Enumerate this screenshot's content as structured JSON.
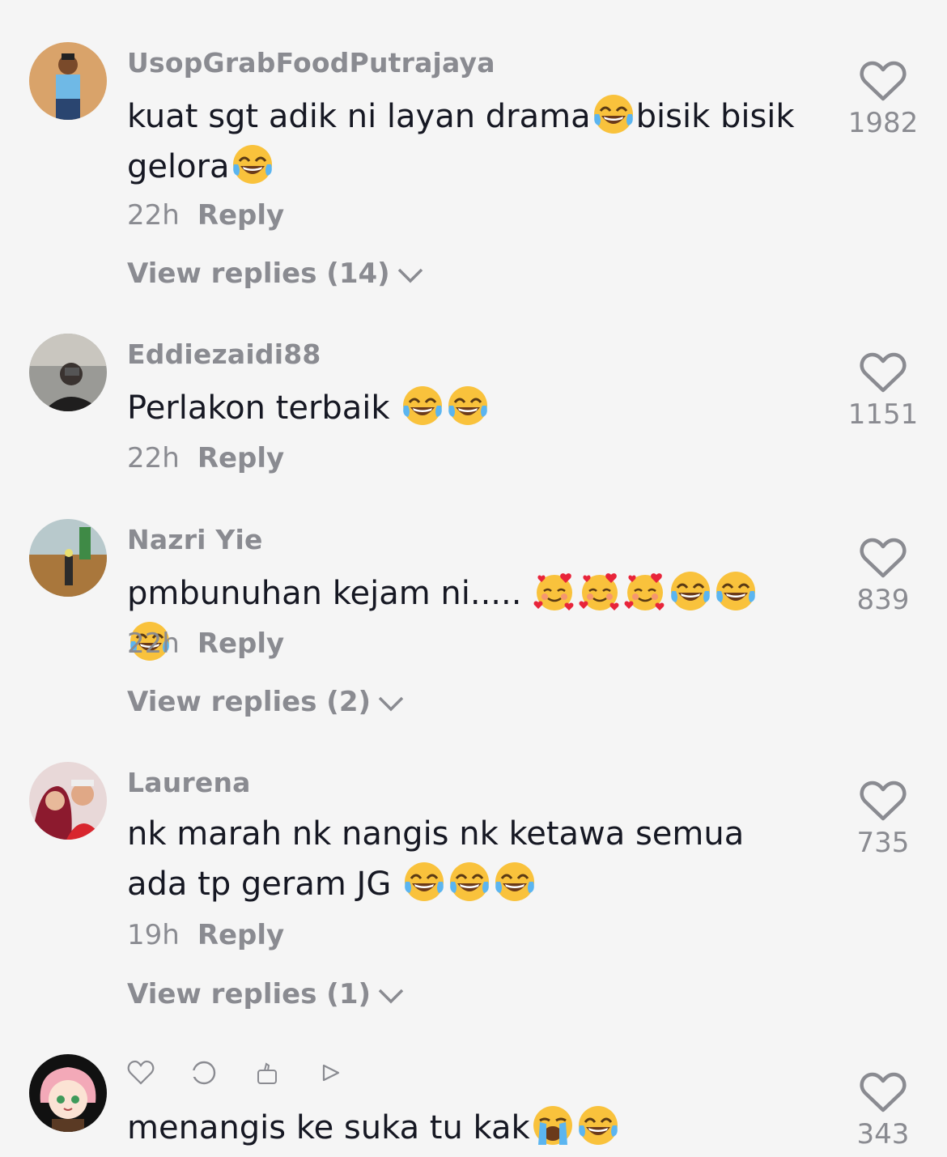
{
  "comments": [
    {
      "username": "UsopGrabFoodPutrajaya",
      "text_parts": [
        "kuat sgt adik ni layan drama",
        "bisik bisik gelora"
      ],
      "time": "22h",
      "reply_label": "Reply",
      "view_replies": "View replies (14)",
      "likes": "1982"
    },
    {
      "username": "Eddiezaidi88",
      "text_parts": [
        "Perlakon terbaik "
      ],
      "time": "22h",
      "reply_label": "Reply",
      "likes": "1151"
    },
    {
      "username": "Nazri Yie",
      "text_parts": [
        "pmbunuhan kejam ni..... "
      ],
      "time": "22h",
      "reply_label": "Reply",
      "view_replies": "View replies (2)",
      "likes": "839"
    },
    {
      "username": "Laurena",
      "text_parts": [
        "nk marah nk nangis nk ketawa semua ada tp geram JG "
      ],
      "time": "19h",
      "reply_label": "Reply",
      "view_replies": "View replies (1)",
      "likes": "735"
    },
    {
      "username": "",
      "text_parts": [
        "menangis ke suka tu kak"
      ],
      "likes": "343"
    }
  ],
  "icons": {
    "laugh_emoji": "face-with-tears-of-joy-emoji",
    "love_emoji": "smiling-face-with-hearts-emoji",
    "cry_emoji": "loudly-crying-face-emoji",
    "like": "heart-outline-icon",
    "chevron": "chevron-down-icon"
  },
  "colors": {
    "background": "#f5f5f5",
    "secondary_text": "#8a8b91",
    "primary_text": "#161823",
    "emoji_yellow": "#f9c23c"
  }
}
